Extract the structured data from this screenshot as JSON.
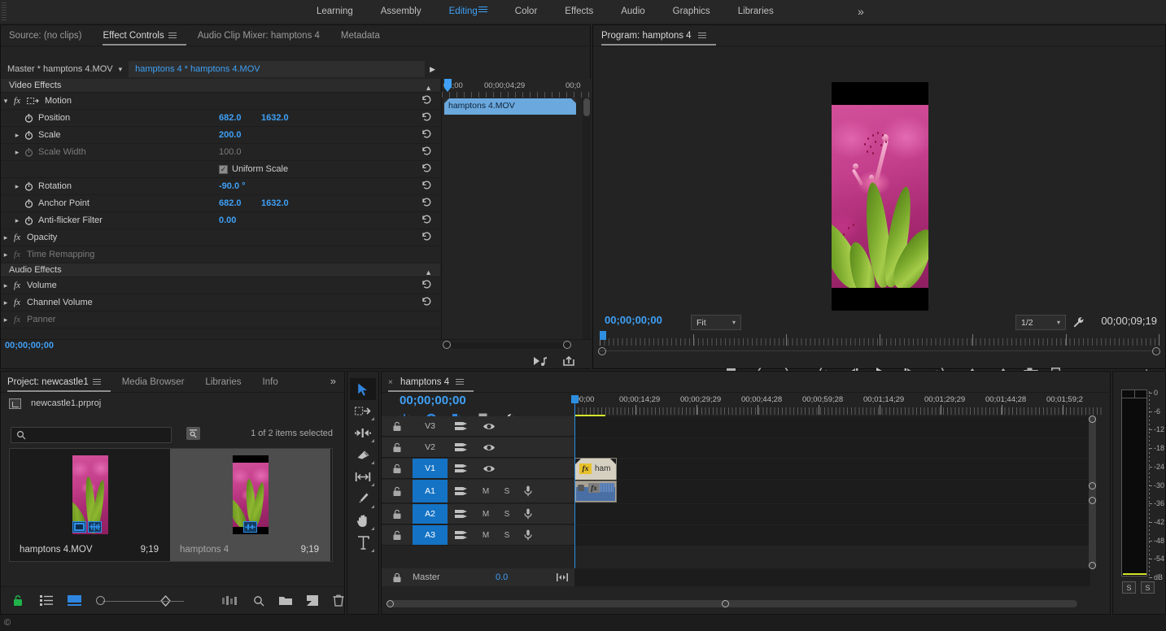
{
  "workspace": {
    "items": [
      {
        "label": "Learning",
        "active": false
      },
      {
        "label": "Assembly",
        "active": false
      },
      {
        "label": "Editing",
        "active": true
      },
      {
        "label": "Color",
        "active": false
      },
      {
        "label": "Effects",
        "active": false
      },
      {
        "label": "Audio",
        "active": false
      },
      {
        "label": "Graphics",
        "active": false
      },
      {
        "label": "Libraries",
        "active": false
      }
    ],
    "more_label": "»"
  },
  "effect_controls": {
    "tabs": [
      {
        "label": "Source: (no clips)",
        "active": false,
        "burger": false
      },
      {
        "label": "Effect Controls",
        "active": true,
        "burger": true
      },
      {
        "label": "Audio Clip Mixer: hamptons 4",
        "active": false,
        "burger": false
      },
      {
        "label": "Metadata",
        "active": false,
        "burger": false
      }
    ],
    "master_label": "Master * hamptons 4.MOV",
    "sequence_clip_label": "hamptons 4 * hamptons 4.MOV",
    "video_effects_header": "Video Effects",
    "audio_effects_header": "Audio Effects",
    "video_effects": [
      {
        "name": "Motion",
        "indent": 0,
        "twirl": "open",
        "fx": true,
        "has_stopwatch": false,
        "value": "",
        "value2": "",
        "reset": true,
        "dim": false,
        "motion_icon": true
      },
      {
        "name": "Position",
        "indent": 1,
        "twirl": "none",
        "fx": false,
        "has_stopwatch": true,
        "value": "682.0",
        "value2": "1632.0",
        "reset": true,
        "dim": false
      },
      {
        "name": "Scale",
        "indent": 1,
        "twirl": "closed",
        "fx": false,
        "has_stopwatch": true,
        "value": "200.0",
        "value2": "",
        "reset": true,
        "dim": false
      },
      {
        "name": "Scale Width",
        "indent": 1,
        "twirl": "closed",
        "fx": false,
        "has_stopwatch": true,
        "value": "100.0",
        "value2": "",
        "reset": true,
        "dim": true
      },
      {
        "name": "Uniform Scale",
        "indent": 1,
        "twirl": "none",
        "fx": false,
        "has_stopwatch": false,
        "checkbox": true,
        "checked": true,
        "value": "",
        "value2": "",
        "reset": true,
        "dim": false
      },
      {
        "name": "Rotation",
        "indent": 1,
        "twirl": "closed",
        "fx": false,
        "has_stopwatch": true,
        "value": "-90.0 °",
        "value2": "",
        "reset": true,
        "dim": false
      },
      {
        "name": "Anchor Point",
        "indent": 1,
        "twirl": "none",
        "fx": false,
        "has_stopwatch": true,
        "value": "682.0",
        "value2": "1632.0",
        "reset": true,
        "dim": false
      },
      {
        "name": "Anti-flicker Filter",
        "indent": 1,
        "twirl": "closed",
        "fx": false,
        "has_stopwatch": true,
        "value": "0.00",
        "value2": "",
        "reset": true,
        "dim": false
      },
      {
        "name": "Opacity",
        "indent": 0,
        "twirl": "closed",
        "fx": true,
        "has_stopwatch": false,
        "value": "",
        "value2": "",
        "reset": true,
        "dim": false
      },
      {
        "name": "Time Remapping",
        "indent": 0,
        "twirl": "closed",
        "fx": true,
        "has_stopwatch": false,
        "value": "",
        "value2": "",
        "reset": false,
        "dim": true
      }
    ],
    "audio_effects": [
      {
        "name": "Volume",
        "indent": 0,
        "twirl": "closed",
        "fx": true,
        "has_stopwatch": false,
        "value": "",
        "value2": "",
        "reset": true,
        "dim": false
      },
      {
        "name": "Channel Volume",
        "indent": 0,
        "twirl": "closed",
        "fx": true,
        "has_stopwatch": false,
        "value": "",
        "value2": "",
        "reset": true,
        "dim": false
      },
      {
        "name": "Panner",
        "indent": 0,
        "twirl": "closed",
        "fx": true,
        "has_stopwatch": false,
        "value": "",
        "value2": "",
        "reset": false,
        "dim": true
      }
    ],
    "ruler_labels": [
      "00;00",
      "00;00;04;29",
      "00;0"
    ],
    "clip_strip_label": "hamptons 4.MOV",
    "timecode": "00;00;00;00"
  },
  "program_monitor": {
    "tab_label": "Program: hamptons 4",
    "timecode_left": "00;00;00;00",
    "zoom_level": "Fit",
    "resolution": "1/2",
    "timecode_right": "00;00;09;19",
    "transport_buttons": [
      {
        "name": "add-marker-button",
        "icon": "marker"
      },
      {
        "name": "mark-in-button",
        "icon": "mark-in"
      },
      {
        "name": "mark-out-button",
        "icon": "mark-out"
      },
      {
        "name": "go-to-in-button",
        "icon": "go-to-in"
      },
      {
        "name": "step-back-button",
        "icon": "step-back"
      },
      {
        "name": "play-stop-button",
        "icon": "play"
      },
      {
        "name": "step-forward-button",
        "icon": "step-forward"
      },
      {
        "name": "go-to-out-button",
        "icon": "go-to-out"
      },
      {
        "name": "lift-button",
        "icon": "lift"
      },
      {
        "name": "extract-button",
        "icon": "extract"
      },
      {
        "name": "export-frame-button",
        "icon": "camera"
      },
      {
        "name": "comparison-view-button",
        "icon": "comparison"
      }
    ],
    "button_plus": "+"
  },
  "project_panel": {
    "tabs": [
      {
        "label": "Project: newcastle1",
        "active": true,
        "burger": true
      },
      {
        "label": "Media Browser",
        "active": false,
        "burger": false
      },
      {
        "label": "Libraries",
        "active": false,
        "burger": false
      },
      {
        "label": "Info",
        "active": false,
        "burger": false
      }
    ],
    "more_label": "»",
    "project_file": "newcastle1.prproj",
    "search_value": "",
    "search_placeholder": "",
    "selection_status": "1 of 2 items selected",
    "items": [
      {
        "name": "hamptons 4.MOV",
        "duration": "9;19",
        "selected": false,
        "type": "clip",
        "badges": [
          "video",
          "audio"
        ]
      },
      {
        "name": "hamptons 4",
        "duration": "9;19",
        "selected": true,
        "type": "sequence",
        "badges": [
          "sequence"
        ]
      }
    ]
  },
  "tools": [
    {
      "name": "selection-tool",
      "icon": "arrow",
      "active": true,
      "has_submenu": false
    },
    {
      "name": "track-select-forward-tool",
      "icon": "track-select",
      "active": false,
      "has_submenu": true
    },
    {
      "name": "ripple-edit-tool",
      "icon": "ripple-edit",
      "active": false,
      "has_submenu": true
    },
    {
      "name": "razor-tool",
      "icon": "razor",
      "active": false,
      "has_submenu": true
    },
    {
      "name": "slip-tool",
      "icon": "slip",
      "active": false,
      "has_submenu": true
    },
    {
      "name": "pen-tool",
      "icon": "pen",
      "active": false,
      "has_submenu": true
    },
    {
      "name": "hand-tool",
      "icon": "hand",
      "active": false,
      "has_submenu": true
    },
    {
      "name": "type-tool",
      "icon": "type",
      "active": false,
      "has_submenu": true
    }
  ],
  "timeline": {
    "tab_label": "hamptons 4",
    "close_label": "×",
    "timecode": "00;00;00;00",
    "toolbar": [
      {
        "name": "nest-sequence-button",
        "icon": "nest"
      },
      {
        "name": "snap-button",
        "icon": "magnet",
        "active": true
      },
      {
        "name": "linked-selection-button",
        "icon": "linked",
        "active": true
      },
      {
        "name": "add-marker-button",
        "icon": "marker"
      },
      {
        "name": "timeline-settings-button",
        "icon": "wrench"
      }
    ],
    "ruler_labels": [
      ";00;00",
      "00;00;14;29",
      "00;00;29;29",
      "00;00;44;28",
      "00;00;59;28",
      "00;01;14;29",
      "00;01;29;29",
      "00;01;44;28",
      "00;01;59;2"
    ],
    "tracks": [
      {
        "name": "V3",
        "type": "video",
        "targeted": false,
        "sync_lock": false,
        "eye": true
      },
      {
        "name": "V2",
        "type": "video",
        "targeted": false,
        "sync_lock": false,
        "eye": true
      },
      {
        "name": "V1",
        "type": "video",
        "targeted": true,
        "sync_lock": false,
        "eye": true
      },
      {
        "name": "A1",
        "type": "audio",
        "targeted": true,
        "mute": "M",
        "solo": "S",
        "mic": true
      },
      {
        "name": "A2",
        "type": "audio",
        "targeted": true,
        "mute": "M",
        "solo": "S",
        "mic": true
      },
      {
        "name": "A3",
        "type": "audio",
        "targeted": true,
        "mute": "M",
        "solo": "S",
        "mic": true
      }
    ],
    "master_label": "Master",
    "master_value": "0.0",
    "clips": [
      {
        "track": "V1",
        "label": "ham",
        "fx_badge": "fx"
      },
      {
        "track": "A1",
        "label": "",
        "fx_badge": "fx"
      }
    ]
  },
  "audio_meters": {
    "scale_labels": [
      "0",
      "-6",
      "-12",
      "-18",
      "-24",
      "-30",
      "-36",
      "-42",
      "-48",
      "-54",
      "dB"
    ],
    "solo_buttons": [
      "S",
      "S"
    ]
  },
  "colors": {
    "accent_blue": "#3fa0f5",
    "target_blue": "#1473c4",
    "panel_bg": "#232323",
    "track_bg": "#1c1c1c",
    "clip_video": "#d5d0c0",
    "clip_audio": "#a8a296",
    "fx_yellow": "#e8c12a",
    "meter_yellow": "#d6e72a"
  }
}
